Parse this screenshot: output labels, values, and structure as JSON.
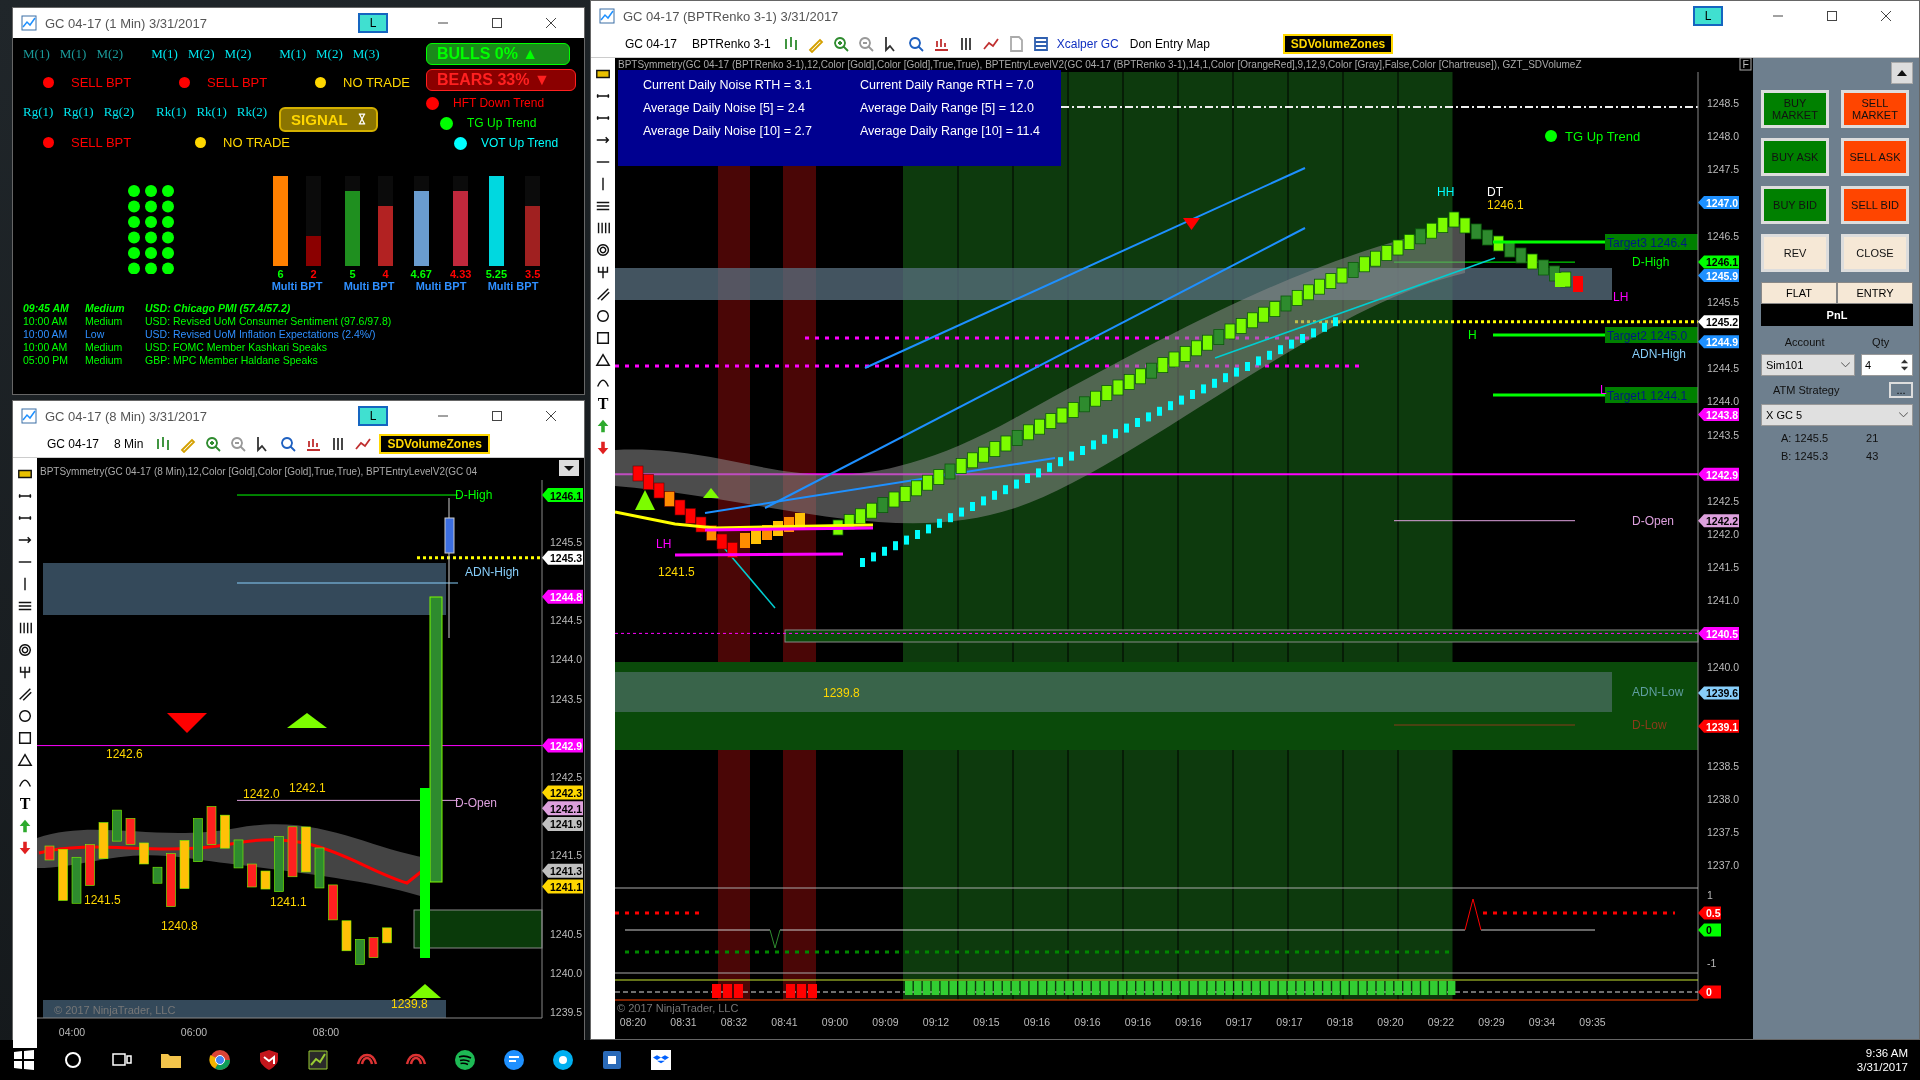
{
  "signal_window": {
    "title": "GC 04-17 (1 Min)  3/31/2017",
    "link_button": "L",
    "mode_groups": [
      {
        "labels": [
          "M(1)",
          "M(1)",
          "M(2)"
        ],
        "dim": true
      },
      {
        "labels": [
          "M(1)",
          "M(2)",
          "M(2)"
        ],
        "dim": false
      },
      {
        "labels": [
          "M(1)",
          "M(2)",
          "M(3)"
        ],
        "dim": false
      }
    ],
    "mode_signals": [
      {
        "text": "SELL BPT",
        "color": "#ff0000"
      },
      {
        "text": "SELL BPT",
        "color": "#ff0000"
      },
      {
        "text": "NO TRADE",
        "color": "#ffd700"
      }
    ],
    "range_groups": [
      {
        "labels": [
          "Rg(1)",
          "Rg(1)",
          "Rg(2)"
        ]
      },
      {
        "labels": [
          "Rk(1)",
          "Rk(1)",
          "Rk(2)"
        ]
      }
    ],
    "range_signals": [
      {
        "text": "SELL BPT",
        "color": "#ff0000"
      },
      {
        "text": "NO TRADE",
        "color": "#ffd700"
      }
    ],
    "signal_badge": "SIGNAL",
    "bulls": {
      "text": "BULLS 0%",
      "arrow": "▲"
    },
    "bears": {
      "text": "BEARS 33%",
      "arrow": "▼"
    },
    "trends": [
      {
        "text": "HFT Down Trend",
        "color": "#ff0000"
      },
      {
        "text": "TG Up Trend",
        "color": "#00ff00"
      },
      {
        "text": "VOT Up Trend",
        "color": "#00ffff"
      }
    ],
    "meters": [
      {
        "value": {
          "text": "6",
          "color": "#00ff00"
        },
        "level": 1,
        "color": "#ff8000"
      },
      {
        "value": {
          "text": "2",
          "color": "#ff0000"
        },
        "level": 0.33,
        "color": "#8b0000"
      },
      {
        "value": {
          "text": "5",
          "color": "#00ff00"
        },
        "level": 0.83,
        "color": "#1f8f1f"
      },
      {
        "value": {
          "text": "4",
          "color": "#ff0000"
        },
        "level": 0.67,
        "color": "#b22222"
      },
      {
        "value": {
          "text": "4.67",
          "color": "#00ff00"
        },
        "level": 0.83,
        "color": "#6a9ccf"
      },
      {
        "value": {
          "text": "4.33",
          "color": "#ff0000"
        },
        "level": 0.83,
        "color": "#c0283c"
      },
      {
        "value": {
          "text": "5.25",
          "color": "#00ff00"
        },
        "level": 1,
        "color": "#00d8e0"
      },
      {
        "value": {
          "text": "3.5",
          "color": "#ff0000"
        },
        "level": 0.67,
        "color": "#a02020"
      }
    ],
    "meter_labels": [
      "Multi BPT",
      "Multi BPT",
      "Multi BPT",
      "Multi BPT"
    ],
    "news": [
      {
        "time": "09:45 AM",
        "impact": "Medium",
        "event": "USD: Chicago PMI (57.4/57.2)",
        "color": "#00ff00",
        "current": true
      },
      {
        "time": "10:00 AM",
        "impact": "Medium",
        "event": "USD: Revised UoM Consumer Sentiment (97.6/97.8)",
        "color": "#00ff00",
        "current": false
      },
      {
        "time": "10:00 AM",
        "impact": "Low",
        "event": "USD: Revised UoM Inflation Expectations (2.4%/)",
        "color": "#2f8fff",
        "current": false
      },
      {
        "time": "10:00 AM",
        "impact": "Medium",
        "event": "USD: FOMC Member Kashkari Speaks",
        "color": "#00ff00",
        "current": false
      },
      {
        "time": "05:00 PM",
        "impact": "Medium",
        "event": "GBP: MPC Member Haldane Speaks",
        "color": "#00ff00",
        "current": false
      }
    ]
  },
  "chart_8min": {
    "title": "GC 04-17 (8 Min)  3/31/2017",
    "link_button": "L",
    "instrument": "GC 04-17",
    "interval": "8 Min",
    "indicator_button": "SDVolumeZones",
    "indicators": "BPTSymmetry(GC 04-17 (8 Min),12,Color [Gold],Color [Gold],True,True), BPTEntryLevelV2(GC 04",
    "price_ticks": [
      "1245.5",
      "1244.5",
      "1244.0",
      "1243.5",
      "1242.5",
      "1241.5",
      "1240.5",
      "1240.0",
      "1239.5"
    ],
    "price_markers": [
      {
        "text": "1246.1",
        "color": "#00ff00"
      },
      {
        "text": "1245.3",
        "color": "#ffffff"
      },
      {
        "text": "1244.8",
        "color": "#ff00ff"
      },
      {
        "text": "1242.9",
        "color": "#ff00ff"
      },
      {
        "text": "1242.3",
        "color": "#ffd700"
      },
      {
        "text": "1242.1",
        "color": "#dda0dd"
      },
      {
        "text": "1241.9",
        "color": "#c0c0c0"
      },
      {
        "text": "1241.3",
        "color": "#c0c0c0"
      },
      {
        "text": "1241.1",
        "color": "#ffd700"
      }
    ],
    "level_labels": [
      {
        "text": "D-High",
        "color": "#00ff00"
      },
      {
        "text": "ADN-High",
        "color": "#87cefa"
      },
      {
        "text": "D-Open",
        "color": "#dda0dd"
      }
    ],
    "annotations": [
      "1242.6",
      "1242.0",
      "1242.1",
      "1241.5",
      "1241.1",
      "1240.8",
      "1239.8"
    ],
    "time_ticks": [
      "04:00",
      "06:00",
      "08:00"
    ],
    "copyright": "© 2017 NinjaTrader, LLC",
    "text_tool": "T"
  },
  "main_chart": {
    "title": "GC 04-17 (BPTRenko 3-1)  3/31/2017",
    "link_button": "L",
    "instrument": "GC 04-17",
    "interval": "BPTRenko 3-1",
    "template_link": "Xcalper GC",
    "template": "Don Entry Map",
    "indicator_button": "SDVolumeZones",
    "indicators": "BPTSymmetry(GC 04-17 (BPTRenko 3-1),12,Color [Gold],Color [Gold],True,True), BPTEntryLevelV2(GC 04-17 (BPTRenko 3-1),14,1,Color [OrangeRed],9,12,9,Color [Gray],False,Color [Chartreuse]), GZT_SDVolumeZ",
    "f_button": "F",
    "stats": [
      "Current Daily Noise RTH = 3.1",
      "Current Daily Range RTH = 7.0",
      "Average Daily Noise [5] = 2.4",
      "Average Daily Range [5] = 12.0",
      "Average Daily Noise [10] = 2.7",
      "Average Daily Range [10] = 11.4"
    ],
    "trend_label": "TG Up Trend",
    "price_ticks": [
      "1248.5",
      "1248.0",
      "1247.5",
      "1246.5",
      "1245.5",
      "1244.5",
      "1244.0",
      "1243.5",
      "1242.5",
      "1242.0",
      "1241.5",
      "1241.0",
      "1240.0",
      "1238.5",
      "1238.0",
      "1237.5",
      "1237.0"
    ],
    "price_markers": [
      {
        "text": "1247.0",
        "color": "#1e90ff"
      },
      {
        "text": "1246.1",
        "color": "#00ff00"
      },
      {
        "text": "1245.9",
        "color": "#1e90ff"
      },
      {
        "text": "1245.2",
        "color": "#ffffff"
      },
      {
        "text": "1244.9",
        "color": "#1e90ff"
      },
      {
        "text": "1243.8",
        "color": "#ff00ff"
      },
      {
        "text": "1242.9",
        "color": "#ff00ff"
      },
      {
        "text": "1242.2",
        "color": "#dda0dd"
      },
      {
        "text": "1240.5",
        "color": "#ff00ff"
      },
      {
        "text": "1239.6",
        "color": "#87cefa"
      },
      {
        "text": "1239.1",
        "color": "#ff0000"
      }
    ],
    "targets": [
      "Target3 1246.4",
      "Target2 1245.0",
      "Target1 1244.1"
    ],
    "level_labels": [
      {
        "text": "D-High",
        "color": "#00ff00"
      },
      {
        "text": "ADN-High",
        "color": "#87cefa"
      },
      {
        "text": "D-Open",
        "color": "#dda0dd"
      },
      {
        "text": "ADN-Low",
        "color": "#5f9ea0"
      },
      {
        "text": "D-Low",
        "color": "#8b3a1a"
      }
    ],
    "annotations": [
      {
        "text": "HH",
        "color": "#00ffff"
      },
      {
        "text": "DT",
        "color": "#ffffff"
      },
      {
        "text": "1246.1",
        "color": "#ffd700"
      },
      {
        "text": "LH",
        "color": "#ff00ff"
      },
      {
        "text": "H",
        "color": "#00ff00"
      },
      {
        "text": "L",
        "color": "#ff00ff"
      },
      {
        "text": "LH",
        "color": "#ff00ff"
      },
      {
        "text": "1241.5",
        "color": "#ffd700"
      },
      {
        "text": "1239.8",
        "color": "#ffd700"
      }
    ],
    "oscillator_ticks": [
      "1",
      "-1"
    ],
    "oscillator_markers": [
      {
        "text": "0.5",
        "color": "#ff0000"
      },
      {
        "text": "0",
        "color": "#00ff00"
      },
      {
        "text": "0",
        "color": "#ff0000"
      }
    ],
    "time_ticks": [
      "08:20",
      "08:31",
      "08:32",
      "08:41",
      "09:00",
      "09:09",
      "09:12",
      "09:15",
      "09:16",
      "09:16",
      "09:16",
      "09:16",
      "09:17",
      "09:17",
      "09:18",
      "09:20",
      "09:22",
      "09:29",
      "09:34",
      "09:35"
    ],
    "copyright": "© 2017 NinjaTrader, LLC",
    "text_tool": "T"
  },
  "order_panel": {
    "buttons": [
      {
        "text": "BUY MARKET",
        "kind": "buy"
      },
      {
        "text": "SELL MARKET",
        "kind": "sell"
      },
      {
        "text": "BUY ASK",
        "kind": "buy"
      },
      {
        "text": "SELL ASK",
        "kind": "sell"
      },
      {
        "text": "BUY BID",
        "kind": "buy"
      },
      {
        "text": "SELL BID",
        "kind": "sell"
      },
      {
        "text": "REV",
        "kind": "neutral"
      },
      {
        "text": "CLOSE",
        "kind": "neutral"
      }
    ],
    "flat": "FLAT",
    "entry": "ENTRY",
    "pnl": "PnL",
    "account_label": "Account",
    "qty_label": "Qty",
    "account": "Sim101",
    "qty": "4",
    "atm_label": "ATM Strategy",
    "atm_button": "...",
    "atm": "X GC 5",
    "quotes": [
      {
        "price": "A: 1245.5",
        "size": "21"
      },
      {
        "price": "B: 1245.3",
        "size": "43"
      }
    ]
  },
  "taskbar": {
    "time": "9:36 AM",
    "date": "3/31/2017"
  }
}
